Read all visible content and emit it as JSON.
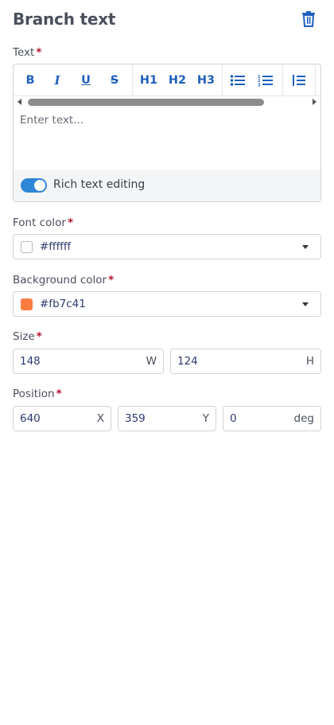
{
  "header": {
    "title": "Branch text",
    "delete_icon": "trash-icon"
  },
  "text_field": {
    "label": "Text",
    "required_mark": "*",
    "toolbar": {
      "bold": "B",
      "italic": "I",
      "underline": "U",
      "strike": "S",
      "h1": "H1",
      "h2": "H2",
      "h3": "H3",
      "bullet_list_icon": "bulleted-list-icon",
      "ordered_list_icon": "numbered-list-icon",
      "blockquote_icon": "blockquote-icon"
    },
    "placeholder": "Enter text...",
    "rich_text_label": "Rich text editing",
    "rich_text_enabled": true
  },
  "font_color": {
    "label": "Font color",
    "required_mark": "*",
    "value": "#ffffff",
    "swatch": "#ffffff"
  },
  "background_color": {
    "label": "Background color",
    "required_mark": "*",
    "value": "#fb7c41",
    "swatch": "#fb7c41"
  },
  "size": {
    "label": "Size",
    "required_mark": "*",
    "width": "148",
    "width_unit": "W",
    "height": "124",
    "height_unit": "H"
  },
  "position": {
    "label": "Position",
    "required_mark": "*",
    "x": "640",
    "x_unit": "X",
    "y": "359",
    "y_unit": "Y",
    "rotation": "0",
    "rotation_unit": "deg"
  },
  "colors": {
    "accent": "#2f86d6",
    "toolbar_icon": "#1f5fbf",
    "required": "#b3122e"
  }
}
